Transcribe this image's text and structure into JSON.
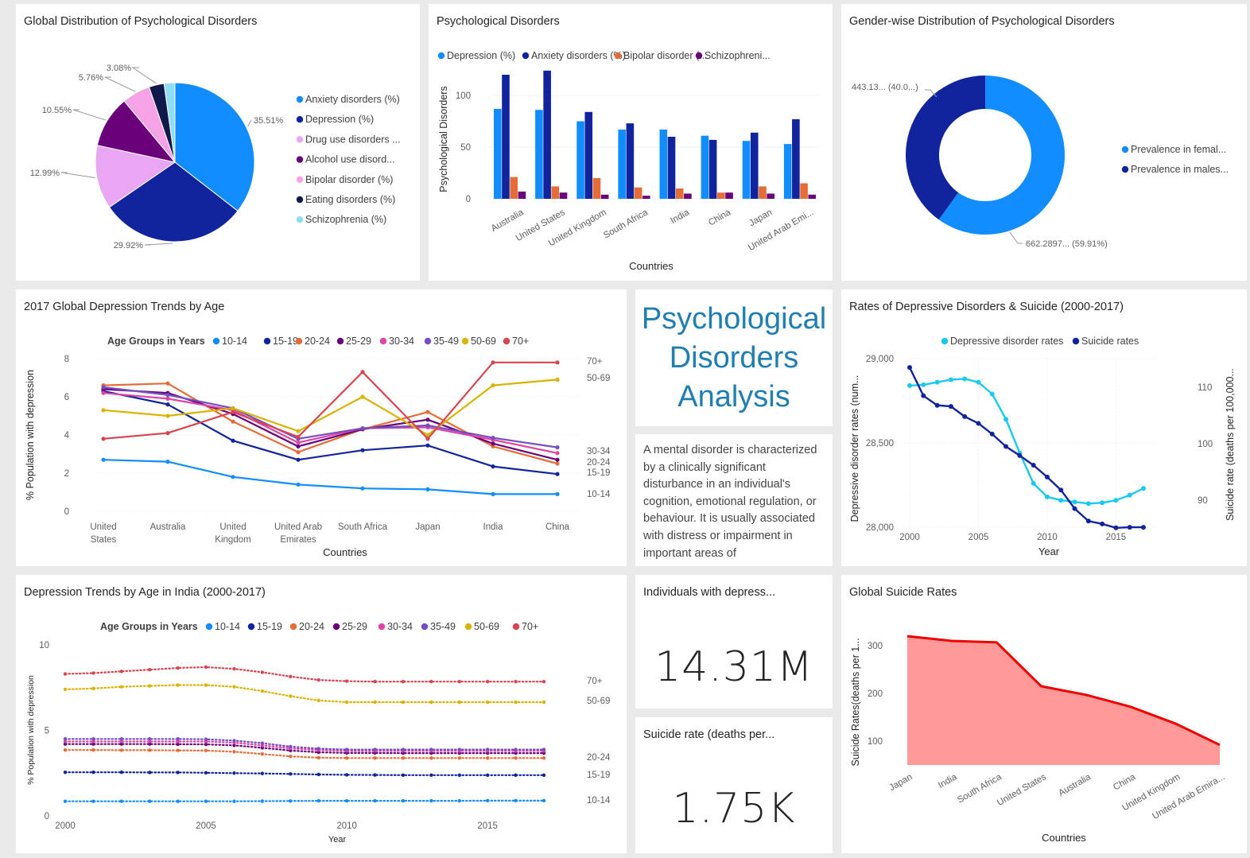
{
  "pie": {
    "title": "Global Distribution of Psychological Disorders",
    "legend": [
      "Anxiety disorders (%)",
      "Depression (%)",
      "Drug use disorders ...",
      "Alcohol use disord...",
      "Bipolar disorder (%)",
      "Eating disorders (%)",
      "Schizophrenia (%)"
    ],
    "colors": [
      "#118dff",
      "#12239e",
      "#e8a6f3",
      "#6b007b",
      "#f5a3e6",
      "#0f1a4a",
      "#8fdcf5"
    ],
    "labels": [
      "35.51%",
      "29.92%",
      "12.99%",
      "10.55%",
      "5.76%",
      "3.08%"
    ]
  },
  "bar": {
    "title": "Psychological Disorders",
    "legend": [
      "Depression (%)",
      "Anxiety disorders (%)",
      "Bipolar disorder (...",
      "Schizophreni..."
    ],
    "colors": [
      "#118dff",
      "#12239e",
      "#e66c37",
      "#6b007b"
    ],
    "ylabel": "Psychological Disorders",
    "xlabel": "Countries",
    "ticks": [
      "0",
      "50",
      "100"
    ]
  },
  "donut": {
    "title": "Gender-wise Distribution of Psychological Disorders",
    "legend": [
      "Prevalence in femal...",
      "Prevalence in males..."
    ],
    "colors": [
      "#118dff",
      "#12239e"
    ],
    "labels": [
      "443.13... (40.0...)",
      "662.2897... (59.91%)"
    ]
  },
  "trend2017": {
    "title": "2017 Global Depression Trends by Age",
    "legend_title": "Age Groups in Years",
    "ylabel": "% Population with depression",
    "xlabel": "Countries",
    "yticks": [
      "0",
      "2",
      "4",
      "6",
      "8"
    ],
    "end_labels": [
      "70+",
      "50-69",
      "30-34",
      "20-24",
      "15-19",
      "10-14"
    ]
  },
  "title_tile": {
    "lines": [
      "Psychological",
      "Disorders",
      "Analysis"
    ]
  },
  "description": "A mental disorder is characterized by a clinically significant disturbance in an individual's cognition, emotional regulation, or behaviour. It is usually associated with distress or impairment in important areas of",
  "dual": {
    "title": "Rates of Depressive Disorders & Suicide (2000-2017)",
    "legend": [
      "Depressive disorder rates",
      "Suicide rates"
    ],
    "colors": [
      "#1ac9f2",
      "#12239e"
    ],
    "ylabel_left": "Depressive disorder rates (num...",
    "ylabel_right": "Suicide rate (deaths per 100,000...",
    "xlabel": "Year",
    "yticks_left": [
      "28,000",
      "28,500",
      "29,000"
    ],
    "yticks_right": [
      "90",
      "100",
      "110"
    ],
    "xticks": [
      "2000",
      "2005",
      "2010",
      "2015"
    ]
  },
  "india": {
    "title": "Depression Trends by Age in India (2000-2017)",
    "legend_title": "Age Groups in Years",
    "ylabel": "% Population with depression",
    "xlabel": "Year",
    "yticks": [
      "0",
      "5",
      "10"
    ],
    "xticks": [
      "2000",
      "2005",
      "2010",
      "2015"
    ],
    "end_labels": [
      "70+",
      "50-69",
      "20-24",
      "15-19",
      "10-14"
    ]
  },
  "card1": {
    "title": "Individuals with depress...",
    "value": "14.31M"
  },
  "card2": {
    "title": "Suicide rate (deaths per...",
    "value": "1.75K"
  },
  "suicide": {
    "title": "Global Suicide Rates",
    "ylabel": "Suicide Rates(deaths per 1...",
    "xlabel": "Countries",
    "yticks": [
      "100",
      "200",
      "300"
    ],
    "fill": "#ff9a98",
    "line": "#ee0000"
  },
  "age_groups": [
    "10-14",
    "15-19",
    "20-24",
    "25-29",
    "30-34",
    "35-49",
    "50-69",
    "70+"
  ],
  "age_colors": [
    "#118dff",
    "#12239e",
    "#e66c37",
    "#6b007b",
    "#e044a7",
    "#744ec2",
    "#d9b300",
    "#d64550"
  ],
  "chart_data": [
    {
      "type": "pie",
      "categories": [
        "Anxiety disorders (%)",
        "Depression (%)",
        "Drug use disorders ...",
        "Alcohol use disord...",
        "Bipolar disorder (%)",
        "Eating disorders (%)",
        "Schizophrenia (%)"
      ],
      "values": [
        35.51,
        29.92,
        12.99,
        10.55,
        5.76,
        3.08,
        2.19
      ]
    },
    {
      "type": "bar",
      "categories": [
        "Australia",
        "United States",
        "United Kingdom",
        "South Africa",
        "India",
        "China",
        "Japan",
        "United Arab Emi..."
      ],
      "series": [
        {
          "name": "Depression (%)",
          "values": [
            87,
            86,
            75,
            67,
            67,
            61,
            56,
            53
          ]
        },
        {
          "name": "Anxiety disorders (%)",
          "values": [
            120,
            124,
            84,
            73,
            60,
            57,
            64,
            77
          ]
        },
        {
          "name": "Bipolar disorder (...",
          "values": [
            21,
            12,
            20,
            11,
            10,
            6,
            12,
            15
          ]
        },
        {
          "name": "Schizophreni...",
          "values": [
            7,
            6,
            4,
            3,
            5,
            6,
            5,
            4
          ]
        }
      ],
      "ylim": [
        0,
        130
      ]
    },
    {
      "type": "pie",
      "categories": [
        "Prevalence in femal...",
        "Prevalence in males..."
      ],
      "values": [
        662.29,
        443.13
      ]
    },
    {
      "type": "line",
      "categories": [
        "United States",
        "Australia",
        "United Kingdom",
        "United Arab Emirates",
        "South Africa",
        "Japan",
        "India",
        "China"
      ],
      "x_labels": [
        [
          "United",
          "States"
        ],
        [
          "Australia"
        ],
        [
          "United",
          "Kingdom"
        ],
        [
          "United Arab",
          "Emirates"
        ],
        [
          "South Africa"
        ],
        [
          "Japan"
        ],
        [
          "India"
        ],
        [
          "China"
        ]
      ],
      "series": [
        {
          "name": "10-14",
          "values": [
            2.7,
            2.6,
            1.8,
            1.4,
            1.2,
            1.15,
            0.9,
            0.9
          ]
        },
        {
          "name": "15-19",
          "values": [
            6.3,
            5.6,
            3.7,
            2.7,
            3.2,
            3.45,
            2.35,
            1.95
          ]
        },
        {
          "name": "20-24",
          "values": [
            6.6,
            6.7,
            4.7,
            3.1,
            4.3,
            5.2,
            3.4,
            2.5
          ]
        },
        {
          "name": "25-29",
          "values": [
            6.4,
            6.2,
            5.1,
            3.4,
            4.3,
            4.8,
            3.55,
            2.7
          ]
        },
        {
          "name": "30-34",
          "values": [
            6.2,
            5.9,
            5.3,
            3.6,
            4.35,
            4.4,
            3.75,
            3.05
          ]
        },
        {
          "name": "35-49",
          "values": [
            6.5,
            6.1,
            5.4,
            3.8,
            4.35,
            4.5,
            3.85,
            3.35
          ]
        },
        {
          "name": "50-69",
          "values": [
            5.3,
            5.0,
            5.4,
            4.2,
            6.0,
            4.0,
            6.6,
            6.9
          ]
        },
        {
          "name": "70+",
          "values": [
            3.8,
            4.1,
            5.2,
            3.9,
            7.3,
            3.8,
            7.8,
            7.8
          ]
        }
      ],
      "ylim": [
        0,
        8
      ]
    },
    {
      "type": "line",
      "x": [
        2000,
        2001,
        2002,
        2003,
        2004,
        2005,
        2006,
        2007,
        2008,
        2009,
        2010,
        2011,
        2012,
        2013,
        2014,
        2015,
        2016,
        2017
      ],
      "series": [
        {
          "name": "Depressive disorder rates",
          "axis": "left",
          "values": [
            28840,
            28845,
            28860,
            28875,
            28880,
            28860,
            28790,
            28640,
            28440,
            28260,
            28180,
            28160,
            28150,
            28140,
            28145,
            28160,
            28190,
            28230
          ]
        },
        {
          "name": "Suicide rates",
          "axis": "right",
          "values": [
            113.5,
            108.5,
            106.8,
            106.6,
            104.8,
            103.6,
            101.7,
            99.5,
            97.9,
            96.2,
            94.1,
            91.8,
            88.5,
            86.3,
            85.8,
            85.1,
            85.2,
            85.2
          ]
        }
      ],
      "ylim_left": [
        28000,
        29000
      ],
      "ylim_right": [
        85,
        115
      ]
    },
    {
      "type": "line",
      "x": [
        2000,
        2001,
        2002,
        2003,
        2004,
        2005,
        2006,
        2007,
        2008,
        2009,
        2010,
        2011,
        2012,
        2013,
        2014,
        2015,
        2016,
        2017
      ],
      "series": [
        {
          "name": "10-14",
          "values": [
            0.85,
            0.85,
            0.85,
            0.85,
            0.85,
            0.85,
            0.85,
            0.86,
            0.87,
            0.88,
            0.88,
            0.88,
            0.88,
            0.88,
            0.88,
            0.89,
            0.89,
            0.89
          ]
        },
        {
          "name": "15-19",
          "values": [
            2.55,
            2.55,
            2.55,
            2.54,
            2.54,
            2.52,
            2.5,
            2.48,
            2.45,
            2.42,
            2.4,
            2.39,
            2.38,
            2.38,
            2.38,
            2.38,
            2.38,
            2.38
          ]
        },
        {
          "name": "20-24",
          "values": [
            3.85,
            3.85,
            3.84,
            3.84,
            3.83,
            3.82,
            3.75,
            3.62,
            3.48,
            3.4,
            3.38,
            3.38,
            3.38,
            3.38,
            3.38,
            3.38,
            3.38,
            3.38
          ]
        },
        {
          "name": "25-29",
          "values": [
            4.2,
            4.2,
            4.2,
            4.2,
            4.19,
            4.18,
            4.12,
            3.98,
            3.82,
            3.72,
            3.68,
            3.68,
            3.67,
            3.67,
            3.67,
            3.67,
            3.67,
            3.67
          ]
        },
        {
          "name": "30-34",
          "values": [
            4.35,
            4.35,
            4.35,
            4.35,
            4.35,
            4.35,
            4.28,
            4.12,
            3.95,
            3.85,
            3.8,
            3.8,
            3.8,
            3.8,
            3.8,
            3.8,
            3.8,
            3.8
          ]
        },
        {
          "name": "35-49",
          "values": [
            4.5,
            4.5,
            4.5,
            4.5,
            4.5,
            4.48,
            4.4,
            4.25,
            4.05,
            3.93,
            3.88,
            3.88,
            3.88,
            3.88,
            3.88,
            3.88,
            3.88,
            3.88
          ]
        },
        {
          "name": "50-69",
          "values": [
            7.4,
            7.45,
            7.55,
            7.6,
            7.65,
            7.65,
            7.55,
            7.3,
            7.0,
            6.75,
            6.65,
            6.65,
            6.65,
            6.65,
            6.65,
            6.65,
            6.65,
            6.65
          ]
        },
        {
          "name": "70+",
          "values": [
            8.3,
            8.35,
            8.45,
            8.55,
            8.65,
            8.7,
            8.6,
            8.4,
            8.15,
            7.95,
            7.88,
            7.85,
            7.85,
            7.85,
            7.85,
            7.85,
            7.85,
            7.85
          ]
        }
      ],
      "ylim": [
        0,
        10
      ]
    },
    {
      "type": "area",
      "categories": [
        "Japan",
        "India",
        "South Africa",
        "United States",
        "Australia",
        "China",
        "United Kingdom",
        "United Arab Emira..."
      ],
      "values": [
        320,
        310,
        307,
        215,
        197,
        172,
        137,
        92
      ],
      "ylim": [
        55,
        335
      ]
    }
  ]
}
